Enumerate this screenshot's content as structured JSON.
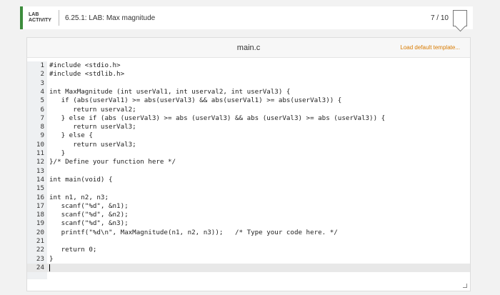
{
  "header": {
    "tag": "LAB\nACTIVITY",
    "title": "6.25.1: LAB: Max magnitude",
    "score": "7 / 10"
  },
  "editor": {
    "filename": "main.c",
    "load_template": "Load default template..."
  },
  "code_lines": [
    "#include <stdio.h>",
    "#include <stdlib.h>",
    "",
    "int MaxMagnitude (int userVal1, int userval2, int userVal3) {",
    "   if (abs(userVal1) >= abs(userVal3) && abs(userVal1) >= abs(userVal3)) {",
    "      return userval2;",
    "   } else if (abs (userVal3) >= abs (userVal3) && abs (userVal3) >= abs (userVal3)) {",
    "      return userVal3;",
    "   } else {",
    "      return userVal3;",
    "   }",
    "}/* Define your function here */",
    "",
    "int main(void) {",
    "",
    "int n1, n2, n3;",
    "   scanf(\"%d\", &n1);",
    "   scanf(\"%d\", &n2);",
    "   scanf(\"%d\", &n3);",
    "   printf(\"%d\\n\", MaxMagnitude(n1, n2, n3));   /* Type your code here. */",
    "",
    "   return 0;",
    "}",
    ""
  ]
}
